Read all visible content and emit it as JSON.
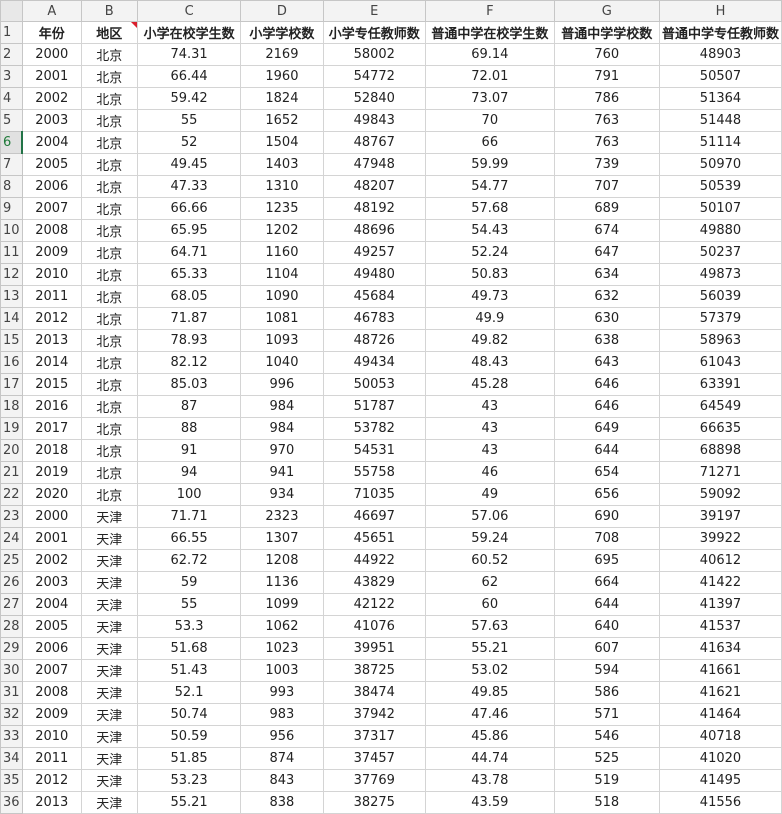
{
  "columns": [
    "A",
    "B",
    "C",
    "D",
    "E",
    "F",
    "G",
    "H"
  ],
  "comment_cell": "B1",
  "active_row": 6,
  "colors": {
    "grid": "#d4d4d4",
    "header_bg": "#f3f3f3",
    "active_row": "#1f7a3a",
    "comment_marker": "#d9202e"
  },
  "rows": [
    {
      "n": "1",
      "cells": [
        "年份",
        "地区",
        "小学在校学生数",
        "小学学校数",
        "小学专任教师数",
        "普通中学在校学生数",
        "普通中学学校数",
        "普通中学专任教师数"
      ]
    },
    {
      "n": "2",
      "cells": [
        "2000",
        "北京",
        "74.31",
        "2169",
        "58002",
        "69.14",
        "760",
        "48903"
      ]
    },
    {
      "n": "3",
      "cells": [
        "2001",
        "北京",
        "66.44",
        "1960",
        "54772",
        "72.01",
        "791",
        "50507"
      ]
    },
    {
      "n": "4",
      "cells": [
        "2002",
        "北京",
        "59.42",
        "1824",
        "52840",
        "73.07",
        "786",
        "51364"
      ]
    },
    {
      "n": "5",
      "cells": [
        "2003",
        "北京",
        "55",
        "1652",
        "49843",
        "70",
        "763",
        "51448"
      ]
    },
    {
      "n": "6",
      "cells": [
        "2004",
        "北京",
        "52",
        "1504",
        "48767",
        "66",
        "763",
        "51114"
      ]
    },
    {
      "n": "7",
      "cells": [
        "2005",
        "北京",
        "49.45",
        "1403",
        "47948",
        "59.99",
        "739",
        "50970"
      ]
    },
    {
      "n": "8",
      "cells": [
        "2006",
        "北京",
        "47.33",
        "1310",
        "48207",
        "54.77",
        "707",
        "50539"
      ]
    },
    {
      "n": "9",
      "cells": [
        "2007",
        "北京",
        "66.66",
        "1235",
        "48192",
        "57.68",
        "689",
        "50107"
      ]
    },
    {
      "n": "10",
      "cells": [
        "2008",
        "北京",
        "65.95",
        "1202",
        "48696",
        "54.43",
        "674",
        "49880"
      ]
    },
    {
      "n": "11",
      "cells": [
        "2009",
        "北京",
        "64.71",
        "1160",
        "49257",
        "52.24",
        "647",
        "50237"
      ]
    },
    {
      "n": "12",
      "cells": [
        "2010",
        "北京",
        "65.33",
        "1104",
        "49480",
        "50.83",
        "634",
        "49873"
      ]
    },
    {
      "n": "13",
      "cells": [
        "2011",
        "北京",
        "68.05",
        "1090",
        "45684",
        "49.73",
        "632",
        "56039"
      ]
    },
    {
      "n": "14",
      "cells": [
        "2012",
        "北京",
        "71.87",
        "1081",
        "46783",
        "49.9",
        "630",
        "57379"
      ]
    },
    {
      "n": "15",
      "cells": [
        "2013",
        "北京",
        "78.93",
        "1093",
        "48726",
        "49.82",
        "638",
        "58963"
      ]
    },
    {
      "n": "16",
      "cells": [
        "2014",
        "北京",
        "82.12",
        "1040",
        "49434",
        "48.43",
        "643",
        "61043"
      ]
    },
    {
      "n": "17",
      "cells": [
        "2015",
        "北京",
        "85.03",
        "996",
        "50053",
        "45.28",
        "646",
        "63391"
      ]
    },
    {
      "n": "18",
      "cells": [
        "2016",
        "北京",
        "87",
        "984",
        "51787",
        "43",
        "646",
        "64549"
      ]
    },
    {
      "n": "19",
      "cells": [
        "2017",
        "北京",
        "88",
        "984",
        "53782",
        "43",
        "649",
        "66635"
      ]
    },
    {
      "n": "20",
      "cells": [
        "2018",
        "北京",
        "91",
        "970",
        "54531",
        "43",
        "644",
        "68898"
      ]
    },
    {
      "n": "21",
      "cells": [
        "2019",
        "北京",
        "94",
        "941",
        "55758",
        "46",
        "654",
        "71271"
      ]
    },
    {
      "n": "22",
      "cells": [
        "2020",
        "北京",
        "100",
        "934",
        "71035",
        "49",
        "656",
        "59092"
      ]
    },
    {
      "n": "23",
      "cells": [
        "2000",
        "天津",
        "71.71",
        "2323",
        "46697",
        "57.06",
        "690",
        "39197"
      ]
    },
    {
      "n": "24",
      "cells": [
        "2001",
        "天津",
        "66.55",
        "1307",
        "45651",
        "59.24",
        "708",
        "39922"
      ]
    },
    {
      "n": "25",
      "cells": [
        "2002",
        "天津",
        "62.72",
        "1208",
        "44922",
        "60.52",
        "695",
        "40612"
      ]
    },
    {
      "n": "26",
      "cells": [
        "2003",
        "天津",
        "59",
        "1136",
        "43829",
        "62",
        "664",
        "41422"
      ]
    },
    {
      "n": "27",
      "cells": [
        "2004",
        "天津",
        "55",
        "1099",
        "42122",
        "60",
        "644",
        "41397"
      ]
    },
    {
      "n": "28",
      "cells": [
        "2005",
        "天津",
        "53.3",
        "1062",
        "41076",
        "57.63",
        "640",
        "41537"
      ]
    },
    {
      "n": "29",
      "cells": [
        "2006",
        "天津",
        "51.68",
        "1023",
        "39951",
        "55.21",
        "607",
        "41634"
      ]
    },
    {
      "n": "30",
      "cells": [
        "2007",
        "天津",
        "51.43",
        "1003",
        "38725",
        "53.02",
        "594",
        "41661"
      ]
    },
    {
      "n": "31",
      "cells": [
        "2008",
        "天津",
        "52.1",
        "993",
        "38474",
        "49.85",
        "586",
        "41621"
      ]
    },
    {
      "n": "32",
      "cells": [
        "2009",
        "天津",
        "50.74",
        "983",
        "37942",
        "47.46",
        "571",
        "41464"
      ]
    },
    {
      "n": "33",
      "cells": [
        "2010",
        "天津",
        "50.59",
        "956",
        "37317",
        "45.86",
        "546",
        "40718"
      ]
    },
    {
      "n": "34",
      "cells": [
        "2011",
        "天津",
        "51.85",
        "874",
        "37457",
        "44.74",
        "525",
        "41020"
      ]
    },
    {
      "n": "35",
      "cells": [
        "2012",
        "天津",
        "53.23",
        "843",
        "37769",
        "43.78",
        "519",
        "41495"
      ]
    },
    {
      "n": "36",
      "cells": [
        "2013",
        "天津",
        "55.21",
        "838",
        "38275",
        "43.59",
        "518",
        "41556"
      ]
    }
  ]
}
